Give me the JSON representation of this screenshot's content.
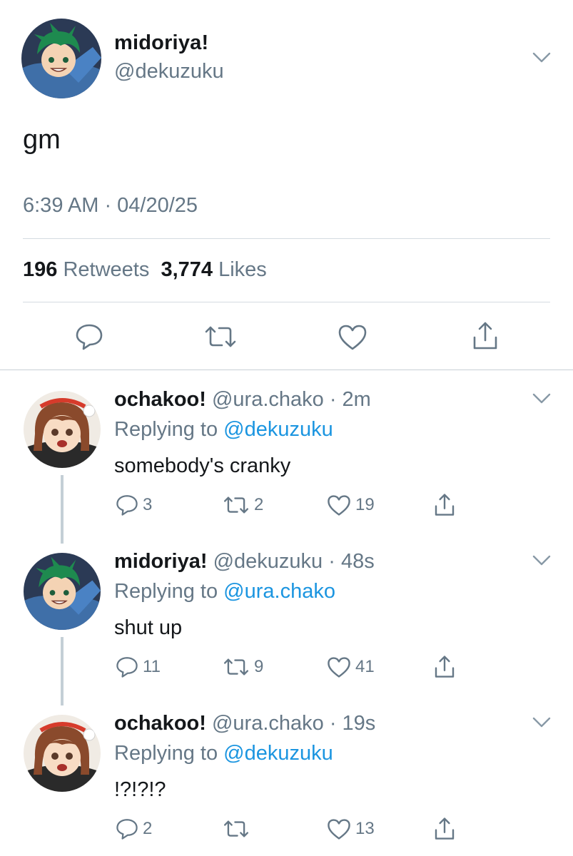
{
  "tweet": {
    "author_name": "midoriya!",
    "author_handle": "@dekuzuku",
    "text": "gm",
    "timestamp": "6:39 AM · 04/20/25",
    "retweets_count": "196",
    "retweets_label": "Retweets",
    "likes_count": "3,774",
    "likes_label": "Likes",
    "icons": [
      "reply-icon",
      "retweet-icon",
      "like-icon",
      "share-icon"
    ]
  },
  "replies": [
    {
      "author_name": "ochakoo!",
      "author_handle": "@ura.chako",
      "time": "· 2m",
      "replying_label": "Replying to",
      "replying_to": "@dekuzuku",
      "text": "somebody's cranky",
      "reply_count": "3",
      "retweet_count": "2",
      "like_count": "19"
    },
    {
      "author_name": "midoriya!",
      "author_handle": "@dekuzuku",
      "time": "· 48s",
      "replying_label": "Replying to",
      "replying_to": "@ura.chako",
      "text": "shut up",
      "reply_count": "11",
      "retweet_count": "9",
      "like_count": "41"
    },
    {
      "author_name": "ochakoo!",
      "author_handle": "@ura.chako",
      "time": "· 19s",
      "replying_label": "Replying to",
      "replying_to": "@dekuzuku",
      "text": "!?!?!?",
      "reply_count": "2",
      "retweet_count": "",
      "like_count": "13"
    }
  ],
  "colors": {
    "text": "#14171a",
    "secondary": "#657786",
    "link": "#1b95e0",
    "divider": "#d4dbe0",
    "thread_line": "#c4cfd6"
  }
}
